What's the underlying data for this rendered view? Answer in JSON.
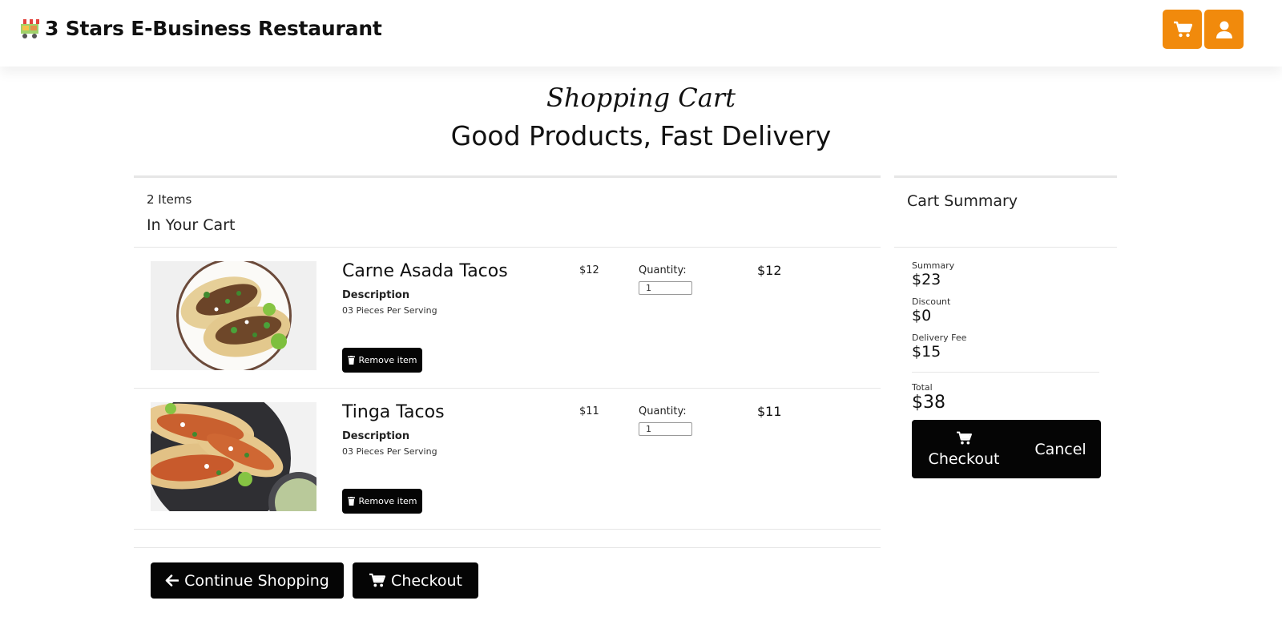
{
  "brand": {
    "name": "3 Stars E-Business Restaurant",
    "logo_icon": "food-cart-icon"
  },
  "nav": {
    "cart_icon": "cart-icon",
    "user_icon": "user-icon",
    "accent_color": "#f18a0c"
  },
  "header": {
    "script_title": "Shopping Cart",
    "title": "Good Products, Fast Delivery"
  },
  "cart": {
    "items_count": "2 Items",
    "subtitle": "In Your Cart",
    "items": [
      {
        "name": "Carne Asada Tacos",
        "description_label": "Description",
        "description": "03 Pieces Per Serving",
        "unit_price": "$12",
        "quantity_label": "Quantity:",
        "quantity": "1",
        "line_total": "$12",
        "remove_label": "Remove item"
      },
      {
        "name": "Tinga Tacos",
        "description_label": "Description",
        "description": "03 Pieces Per Serving",
        "unit_price": "$11",
        "quantity_label": "Quantity:",
        "quantity": "1",
        "line_total": "$11",
        "remove_label": "Remove item"
      }
    ],
    "continue_label": "Continue Shopping",
    "checkout_label": "Checkout"
  },
  "summary": {
    "title": "Cart Summary",
    "summary_label": "Summary",
    "summary_value": "$23",
    "discount_label": "Discount",
    "discount_value": "$0",
    "delivery_label": "Delivery Fee",
    "delivery_value": "$15",
    "total_label": "Total",
    "total_value": "$38",
    "checkout_label": "Checkout",
    "cancel_label": "Cancel"
  }
}
